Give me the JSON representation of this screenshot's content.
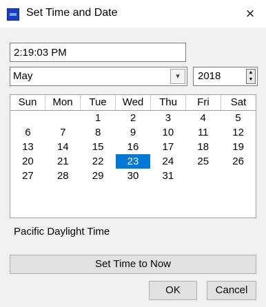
{
  "window": {
    "title": "Set Time and Date",
    "close_glyph": "×",
    "icon": "app-icon"
  },
  "time": {
    "value": "2:19:03 PM"
  },
  "month": {
    "selected": "May",
    "arrow_glyph": "▾"
  },
  "year": {
    "value": "2018",
    "up_glyph": "▲",
    "down_glyph": "▼"
  },
  "calendar": {
    "weekdays": [
      "Sun",
      "Mon",
      "Tue",
      "Wed",
      "Thu",
      "Fri",
      "Sat"
    ],
    "weeks": [
      [
        "",
        "",
        "1",
        "2",
        "3",
        "4",
        "5"
      ],
      [
        "6",
        "7",
        "8",
        "9",
        "10",
        "11",
        "12"
      ],
      [
        "13",
        "14",
        "15",
        "16",
        "17",
        "18",
        "19"
      ],
      [
        "20",
        "21",
        "22",
        "23",
        "24",
        "25",
        "26"
      ],
      [
        "27",
        "28",
        "29",
        "30",
        "31",
        "",
        ""
      ]
    ],
    "selected_day": "23",
    "selected_color": "#0078d7"
  },
  "timezone": {
    "label": "Pacific Daylight Time"
  },
  "buttons": {
    "now": "Set Time to Now",
    "ok": "OK",
    "cancel": "Cancel"
  }
}
